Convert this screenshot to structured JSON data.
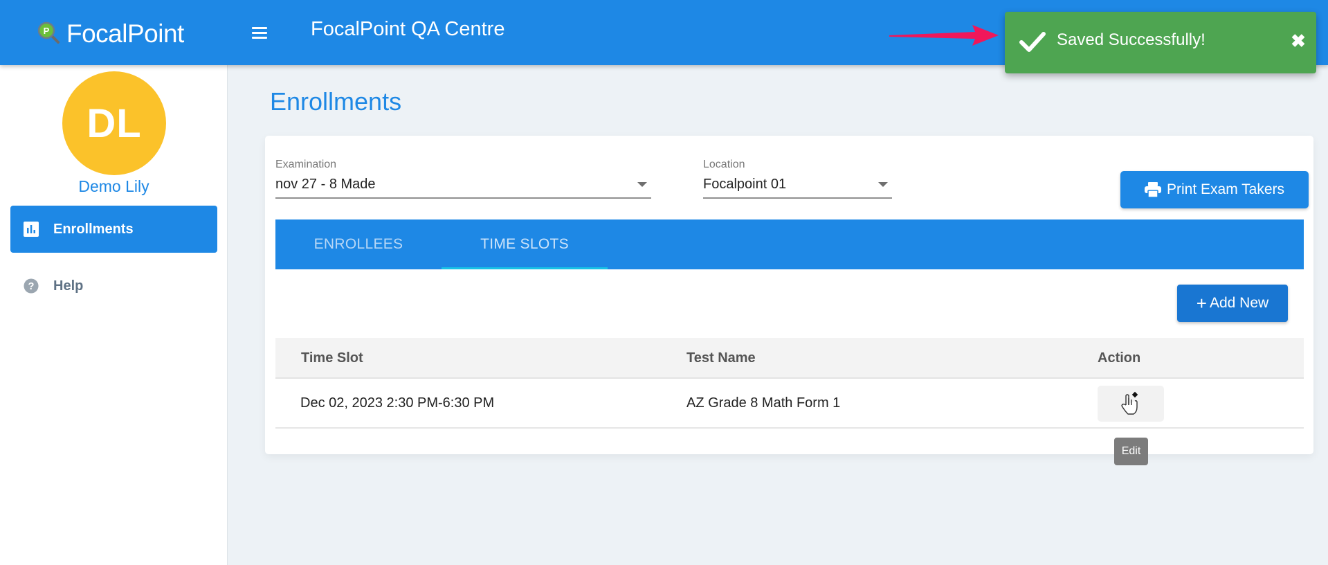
{
  "header": {
    "brand": "FocalPoint",
    "title": "FocalPoint QA Centre",
    "menu_icon": "hamburger-icon",
    "brand_color": "#1e88e5"
  },
  "toast": {
    "message": "Saved Successfully!",
    "icon": "check-icon",
    "close_icon": "close-icon",
    "color": "#4ea551"
  },
  "sidebar": {
    "avatar_initials": "DL",
    "avatar_color": "#fbc22a",
    "user_name": "Demo Lily",
    "items": [
      {
        "label": "Enrollments",
        "icon": "bar-chart-icon",
        "active": true
      },
      {
        "label": "Help",
        "icon": "help-circle-icon",
        "active": false
      }
    ]
  },
  "main": {
    "page_title": "Enrollments",
    "filters": {
      "examination": {
        "label": "Examination",
        "value": "nov 27 - 8 Made"
      },
      "location": {
        "label": "Location",
        "value": "Focalpoint 01"
      }
    },
    "print_button": "Print Exam Takers",
    "tabs": [
      {
        "label": "ENROLLEES",
        "active": false
      },
      {
        "label": "TIME SLOTS",
        "active": true
      }
    ],
    "add_button": "Add New",
    "add_button_prefix": "+",
    "table": {
      "columns": [
        "Time Slot",
        "Test Name",
        "Action"
      ],
      "rows": [
        {
          "time_slot": "Dec 02, 2023 2:30 PM-6:30 PM",
          "test_name": "AZ Grade 8 Math Form 1",
          "action": "edit-icon"
        }
      ]
    },
    "tooltip": "Edit"
  }
}
